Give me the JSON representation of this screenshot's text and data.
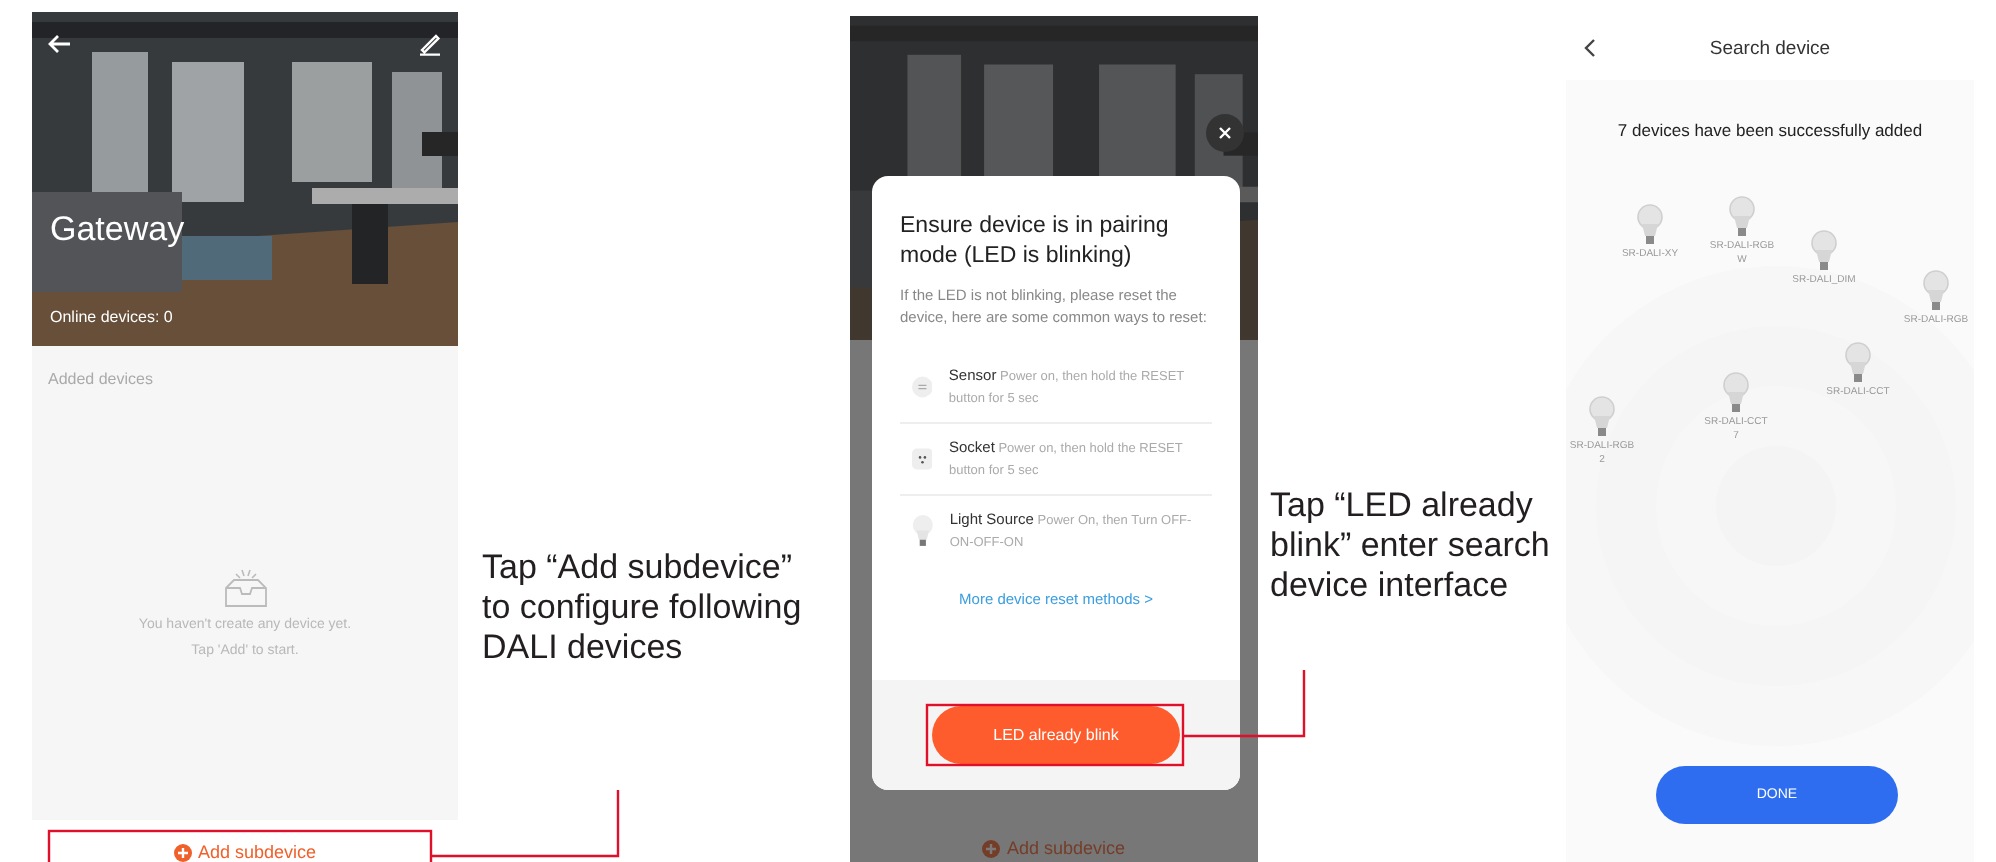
{
  "gateway_screen": {
    "title": "Gateway",
    "online": "Online devices: 0",
    "section": "Added devices",
    "empty_lines": [
      "You haven't create any device yet.",
      "Tap 'Add' to start."
    ],
    "add_button": "Add subdevice"
  },
  "annotation_1": {
    "text": "Tap “Add subdevice” to configure following DALI devices"
  },
  "pairing_screen": {
    "title": "Ensure device is in pairing mode (LED is blinking)",
    "description": "If the LED is not blinking, please reset the device, here are some common ways to reset:",
    "methods": [
      {
        "kind": "sensor",
        "name": "Sensor",
        "text": "Power on, then hold the RESET button for 5 sec"
      },
      {
        "kind": "socket",
        "name": "Socket",
        "text": "Power on, then hold the RESET button for 5 sec"
      },
      {
        "kind": "light",
        "name": "Light Source",
        "text": "Power On, then Turn OFF-ON-OFF-ON"
      }
    ],
    "link": "More device reset methods >",
    "button": "LED already blink",
    "background_add_button": "Add subdevice"
  },
  "annotation_2": {
    "text": "Tap “LED already blink” enter search device interface"
  },
  "search_screen": {
    "title": "Search device",
    "message": "7 devices have been successfully added",
    "devices": [
      {
        "name": "SR-DALI-XY"
      },
      {
        "name": "SR-DALI-RGBW"
      },
      {
        "name": "SR-DALI_DIM"
      },
      {
        "name": "SR-DALI-RGB"
      },
      {
        "name": "SR-DALI-CCT"
      },
      {
        "name": "SR-DALI-CCT 7"
      },
      {
        "name": "SR-DALI-RGB 2"
      }
    ],
    "button": "DONE"
  }
}
